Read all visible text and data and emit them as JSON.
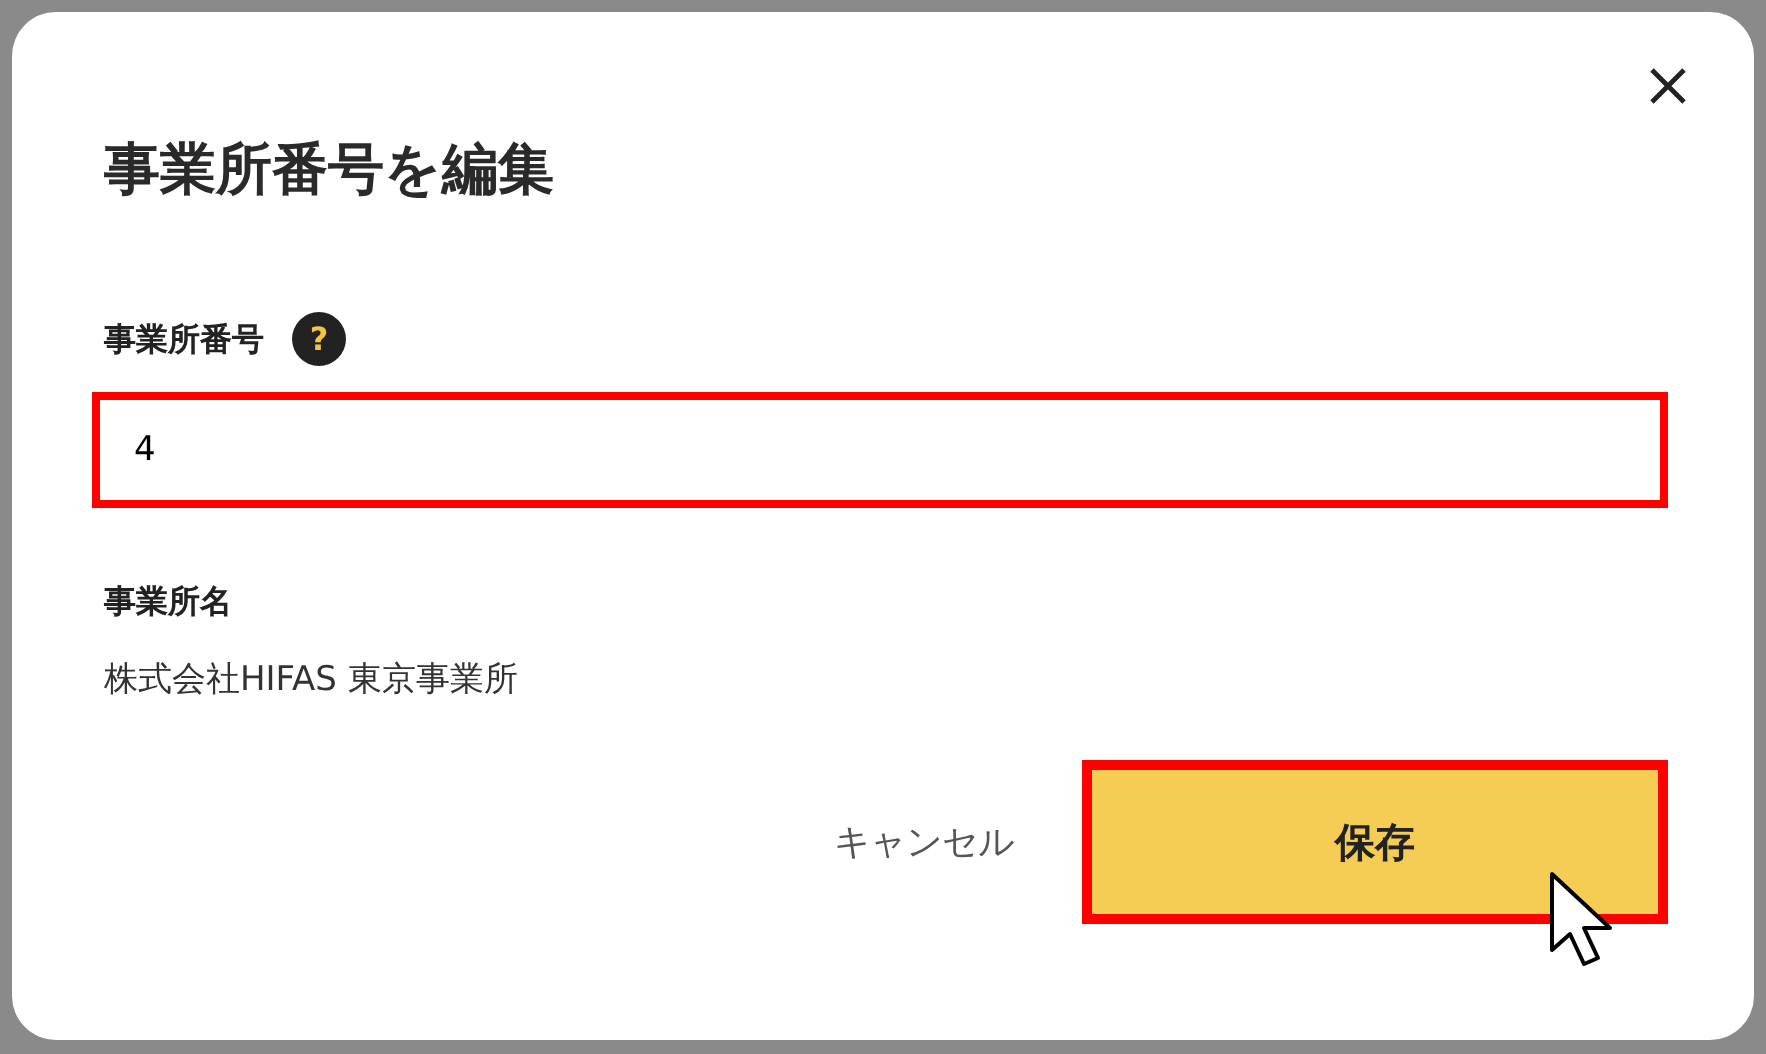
{
  "dialog": {
    "title": "事業所番号を編集",
    "fields": [
      {
        "kind": "input",
        "label": "事業所番号",
        "help": "?",
        "value": "4",
        "highlighted": true
      },
      {
        "kind": "text",
        "label": "事業所名",
        "value": "株式会社HIFAS 東京事業所"
      }
    ],
    "buttons": [
      {
        "kind": "link",
        "label": "キャンセル",
        "highlighted": false
      },
      {
        "kind": "primary",
        "label": "保存",
        "highlighted": true
      }
    ]
  }
}
